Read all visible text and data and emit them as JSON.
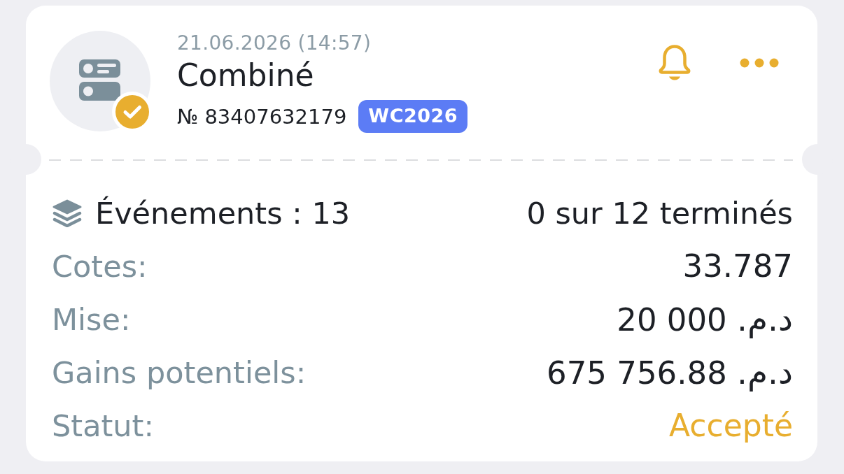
{
  "bet": {
    "date": "21.06.2026 (14:57)",
    "type": "Combiné",
    "number": "№ 83407632179",
    "tag": "WC2026",
    "checked": true
  },
  "events": {
    "label": "Événements : 13",
    "finished": "0 sur 12 terminés"
  },
  "details": [
    {
      "kind": "plain",
      "label": "Cotes:",
      "value": "33.787"
    },
    {
      "kind": "money",
      "label": "Mise:",
      "amount": "20 000",
      "currency": "د.م."
    },
    {
      "kind": "money",
      "label": "Gains potentiels:",
      "amount": "675 756.88",
      "currency": "د.م."
    },
    {
      "kind": "status",
      "label": "Statut:",
      "value": "Accepté"
    }
  ]
}
